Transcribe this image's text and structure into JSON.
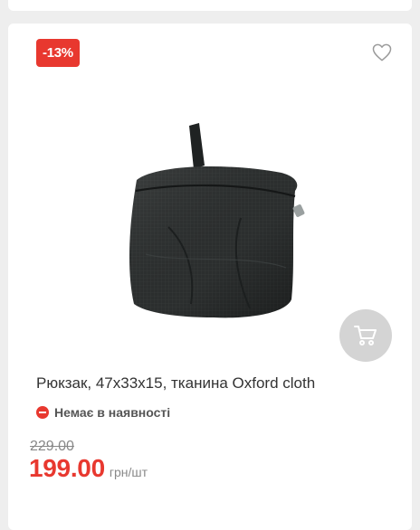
{
  "product": {
    "discount_badge": "-13%",
    "title": "Рюкзак, 47х33х15, тканина Oxford cloth",
    "stock_status": "Немає в наявності",
    "old_price": "229.00",
    "price": "199.00",
    "price_unit": "грн/шт",
    "image_alt": "Рюкзак складений в чохол"
  },
  "icons": {
    "favorite": "heart-icon",
    "cart": "cart-icon",
    "stock": "minus-circle-icon"
  },
  "colors": {
    "accent": "#e8382f",
    "cart_button": "#d4d4d4",
    "text": "#333333"
  }
}
